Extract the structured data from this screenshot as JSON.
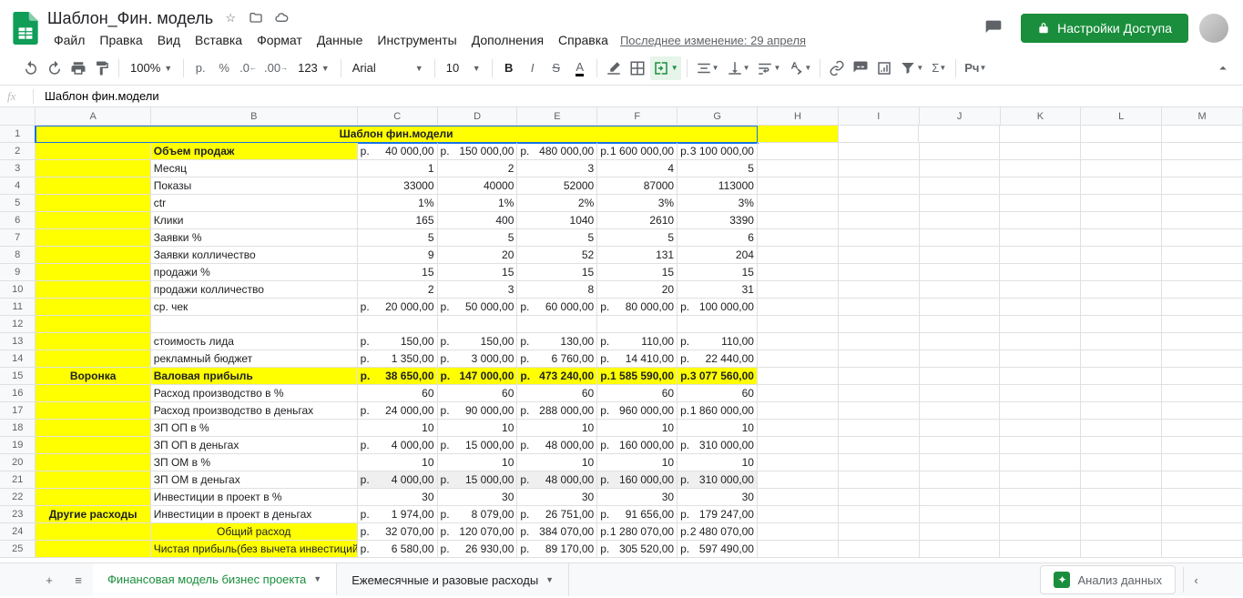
{
  "doc": {
    "title": "Шаблон_Фин. модель"
  },
  "menu": {
    "file": "Файл",
    "edit": "Правка",
    "view": "Вид",
    "insert": "Вставка",
    "format": "Формат",
    "data": "Данные",
    "tools": "Инструменты",
    "addons": "Дополнения",
    "help": "Справка",
    "last_edit": "Последнее изменение: 29 апреля"
  },
  "share": {
    "label": "Настройки Доступа"
  },
  "toolbar": {
    "zoom": "100%",
    "currency": "р.",
    "percent": "%",
    "font": "Arial",
    "font_size": "10"
  },
  "formula": {
    "value": "Шаблон фин.модели"
  },
  "cols": [
    "A",
    "B",
    "C",
    "D",
    "E",
    "F",
    "G",
    "H",
    "I",
    "J",
    "K",
    "L",
    "M"
  ],
  "rows": {
    "r1_merged": "Шаблон фин.модели",
    "r2": {
      "B": "Объем продаж",
      "C": [
        "р.",
        "40 000,00"
      ],
      "D": [
        "р.",
        "150 000,00"
      ],
      "E": [
        "р.",
        "480 000,00"
      ],
      "F": [
        "р.",
        "1 600 000,00"
      ],
      "G": [
        "р.",
        "3 100 000,00"
      ]
    },
    "r3": {
      "B": "Месяц",
      "C": "1",
      "D": "2",
      "E": "3",
      "F": "4",
      "G": "5"
    },
    "r4": {
      "B": "Показы",
      "C": "33000",
      "D": "40000",
      "E": "52000",
      "F": "87000",
      "G": "113000"
    },
    "r5": {
      "B": "ctr",
      "C": "1%",
      "D": "1%",
      "E": "2%",
      "F": "3%",
      "G": "3%"
    },
    "r6": {
      "B": "Клики",
      "C": "165",
      "D": "400",
      "E": "1040",
      "F": "2610",
      "G": "3390"
    },
    "r7": {
      "B": "Заявки %",
      "C": "5",
      "D": "5",
      "E": "5",
      "F": "5",
      "G": "6"
    },
    "r8": {
      "B": "Заявки колличество",
      "C": "9",
      "D": "20",
      "E": "52",
      "F": "131",
      "G": "204"
    },
    "r9": {
      "B": "продажи %",
      "C": "15",
      "D": "15",
      "E": "15",
      "F": "15",
      "G": "15"
    },
    "r10": {
      "B": "продажи колличество",
      "C": "2",
      "D": "3",
      "E": "8",
      "F": "20",
      "G": "31"
    },
    "r11": {
      "B": "ср. чек",
      "C": [
        "р.",
        "20 000,00"
      ],
      "D": [
        "р.",
        "50 000,00"
      ],
      "E": [
        "р.",
        "60 000,00"
      ],
      "F": [
        "р.",
        "80 000,00"
      ],
      "G": [
        "р.",
        "100 000,00"
      ]
    },
    "r13": {
      "B": "стоимость лида",
      "C": [
        "р.",
        "150,00"
      ],
      "D": [
        "р.",
        "150,00"
      ],
      "E": [
        "р.",
        "130,00"
      ],
      "F": [
        "р.",
        "110,00"
      ],
      "G": [
        "р.",
        "110,00"
      ]
    },
    "r14": {
      "B": "рекламный бюджет",
      "C": [
        "р.",
        "1 350,00"
      ],
      "D": [
        "р.",
        "3 000,00"
      ],
      "E": [
        "р.",
        "6 760,00"
      ],
      "F": [
        "р.",
        "14 410,00"
      ],
      "G": [
        "р.",
        "22 440,00"
      ]
    },
    "r15": {
      "A": "Воронка",
      "B": "Валовая прибыль",
      "C": [
        "р.",
        "38 650,00"
      ],
      "D": [
        "р.",
        "147 000,00"
      ],
      "E": [
        "р.",
        "473 240,00"
      ],
      "F": [
        "р.",
        "1 585 590,00"
      ],
      "G": [
        "р.",
        "3 077 560,00"
      ]
    },
    "r16": {
      "B": "Расход производство в %",
      "C": "60",
      "D": "60",
      "E": "60",
      "F": "60",
      "G": "60"
    },
    "r17": {
      "B": "Расход производство в деньгах",
      "C": [
        "р.",
        "24 000,00"
      ],
      "D": [
        "р.",
        "90 000,00"
      ],
      "E": [
        "р.",
        "288 000,00"
      ],
      "F": [
        "р.",
        "960 000,00"
      ],
      "G": [
        "р.",
        "1 860 000,00"
      ]
    },
    "r18": {
      "B": "ЗП ОП в %",
      "C": "10",
      "D": "10",
      "E": "10",
      "F": "10",
      "G": "10"
    },
    "r19": {
      "B": "ЗП ОП в деньгах",
      "C": [
        "р.",
        "4 000,00"
      ],
      "D": [
        "р.",
        "15 000,00"
      ],
      "E": [
        "р.",
        "48 000,00"
      ],
      "F": [
        "р.",
        "160 000,00"
      ],
      "G": [
        "р.",
        "310 000,00"
      ]
    },
    "r20": {
      "B": "ЗП ОМ в %",
      "C": "10",
      "D": "10",
      "E": "10",
      "F": "10",
      "G": "10"
    },
    "r21": {
      "B": "ЗП ОМ в деньгах",
      "C": [
        "р.",
        "4 000,00"
      ],
      "D": [
        "р.",
        "15 000,00"
      ],
      "E": [
        "р.",
        "48 000,00"
      ],
      "F": [
        "р.",
        "160 000,00"
      ],
      "G": [
        "р.",
        "310 000,00"
      ]
    },
    "r22": {
      "B": "Инвестиции в проект в %",
      "C": "30",
      "D": "30",
      "E": "30",
      "F": "30",
      "G": "30"
    },
    "r23": {
      "A": "Другие расходы",
      "B": "Инвестиции в проект в деньгах",
      "C": [
        "р.",
        "1 974,00"
      ],
      "D": [
        "р.",
        "8 079,00"
      ],
      "E": [
        "р.",
        "26 751,00"
      ],
      "F": [
        "р.",
        "91 656,00"
      ],
      "G": [
        "р.",
        "179 247,00"
      ]
    },
    "r24": {
      "B": "Общий расход",
      "C": [
        "р.",
        "32 070,00"
      ],
      "D": [
        "р.",
        "120 070,00"
      ],
      "E": [
        "р.",
        "384 070,00"
      ],
      "F": [
        "р.",
        "1 280 070,00"
      ],
      "G": [
        "р.",
        "2 480 070,00"
      ]
    },
    "r25": {
      "B": "Чистая прибыль(без вычета инвестиций)",
      "C": [
        "р.",
        "6 580,00"
      ],
      "D": [
        "р.",
        "26 930,00"
      ],
      "E": [
        "р.",
        "89 170,00"
      ],
      "F": [
        "р.",
        "305 520,00"
      ],
      "G": [
        "р.",
        "597 490,00"
      ]
    }
  },
  "tabs": {
    "active": "Финансовая модель бизнес проекта",
    "other": "Ежемесячные и разовые расходы"
  },
  "explore": "Анализ данных"
}
